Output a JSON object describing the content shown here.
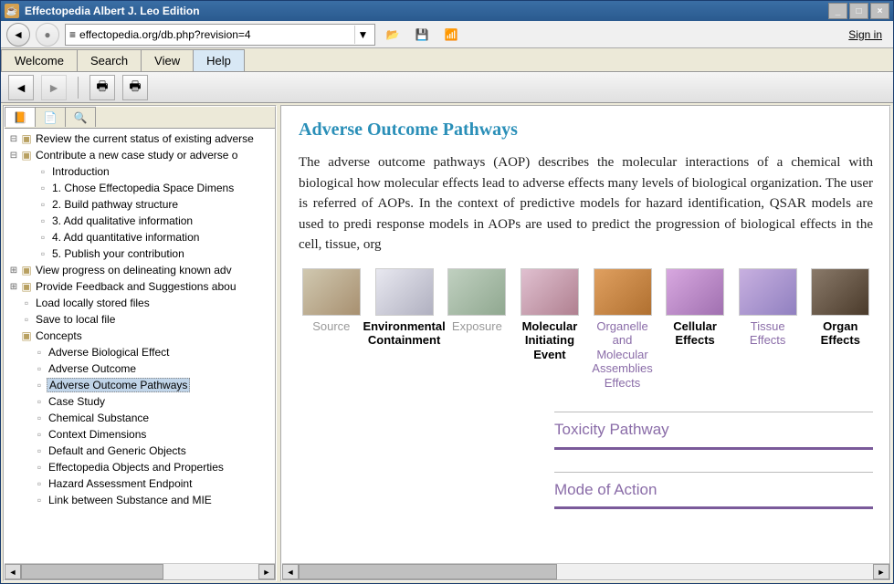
{
  "window": {
    "title": "Effectopedia  Albert J. Leo Edition"
  },
  "toolbar": {
    "url": "effectopedia.org/db.php?revision=4",
    "sign_in": "Sign in"
  },
  "tabs": [
    {
      "label": "Welcome",
      "active": false
    },
    {
      "label": "Search",
      "active": false
    },
    {
      "label": "View",
      "active": false
    },
    {
      "label": "Help",
      "active": true
    }
  ],
  "tree": [
    {
      "depth": 0,
      "toggle": "⊟",
      "icon": "folder",
      "label": "Review the current status of existing adverse"
    },
    {
      "depth": 0,
      "toggle": "⊟",
      "icon": "folder",
      "label": "Contribute a new case study or adverse o"
    },
    {
      "depth": 1,
      "toggle": "",
      "icon": "doc",
      "label": "Introduction"
    },
    {
      "depth": 1,
      "toggle": "",
      "icon": "doc",
      "label": "1. Chose Effectopedia Space Dimens"
    },
    {
      "depth": 1,
      "toggle": "",
      "icon": "doc",
      "label": "2. Build pathway structure"
    },
    {
      "depth": 1,
      "toggle": "",
      "icon": "doc",
      "label": "3. Add qualitative information"
    },
    {
      "depth": 1,
      "toggle": "",
      "icon": "doc",
      "label": "4. Add quantitative information"
    },
    {
      "depth": 1,
      "toggle": "",
      "icon": "doc",
      "label": "5. Publish your contribution"
    },
    {
      "depth": 0,
      "toggle": "⊞",
      "icon": "folder",
      "label": "View progress on delineating known adv"
    },
    {
      "depth": 0,
      "toggle": "⊞",
      "icon": "folder",
      "label": "Provide Feedback and Suggestions abou"
    },
    {
      "depth": 0,
      "toggle": "",
      "icon": "doc",
      "label": "Load locally stored files"
    },
    {
      "depth": 0,
      "toggle": "",
      "icon": "doc",
      "label": "Save to local file"
    },
    {
      "depth": 0,
      "toggle": "",
      "icon": "folder",
      "label": "Concepts",
      "noTogglePad": true
    },
    {
      "depth": 1,
      "toggle": "",
      "icon": "doc",
      "label": "Adverse Biological Effect",
      "conceptChild": true
    },
    {
      "depth": 1,
      "toggle": "",
      "icon": "doc",
      "label": "Adverse Outcome",
      "conceptChild": true
    },
    {
      "depth": 1,
      "toggle": "",
      "icon": "doc",
      "label": "Adverse Outcome Pathways",
      "selected": true,
      "conceptChild": true
    },
    {
      "depth": 1,
      "toggle": "",
      "icon": "doc",
      "label": "Case Study",
      "conceptChild": true
    },
    {
      "depth": 1,
      "toggle": "",
      "icon": "doc",
      "label": "Chemical Substance",
      "conceptChild": true
    },
    {
      "depth": 1,
      "toggle": "",
      "icon": "doc",
      "label": "Context Dimensions",
      "conceptChild": true
    },
    {
      "depth": 1,
      "toggle": "",
      "icon": "doc",
      "label": "Default and Generic Objects",
      "conceptChild": true
    },
    {
      "depth": 1,
      "toggle": "",
      "icon": "doc",
      "label": "Effectopedia Objects and Properties",
      "conceptChild": true
    },
    {
      "depth": 1,
      "toggle": "",
      "icon": "doc",
      "label": "Hazard Assessment Endpoint",
      "conceptChild": true
    },
    {
      "depth": 1,
      "toggle": "",
      "icon": "doc",
      "label": "Link between Substance and MIE",
      "conceptChild": true
    }
  ],
  "content": {
    "heading": "Adverse Outcome Pathways",
    "paragraph": "The adverse outcome pathways (AOP) describes the molecular interactions of a chemical with biological how molecular effects lead to adverse effects many levels of biological organization. The user is referred of AOPs. In the context of predictive models for hazard identification, QSAR models are used to predi response models in AOPs are used to predict the progression of biological effects in the cell, tissue, org",
    "pathway": [
      {
        "label": "Source",
        "cls": "grey"
      },
      {
        "label": "Environmental Containment",
        "cls": "black"
      },
      {
        "label": "Exposure",
        "cls": "grey"
      },
      {
        "label": "Molecular Initiating Event",
        "cls": "black"
      },
      {
        "label": "Organelle and Molecular Assemblies Effects",
        "cls": "purple"
      },
      {
        "label": "Cellular Effects",
        "cls": "black"
      },
      {
        "label": "Tissue Effects",
        "cls": "purple"
      },
      {
        "label": "Organ Effects",
        "cls": "black"
      }
    ],
    "section1": "Toxicity Pathway",
    "section2": "Mode of Action"
  }
}
